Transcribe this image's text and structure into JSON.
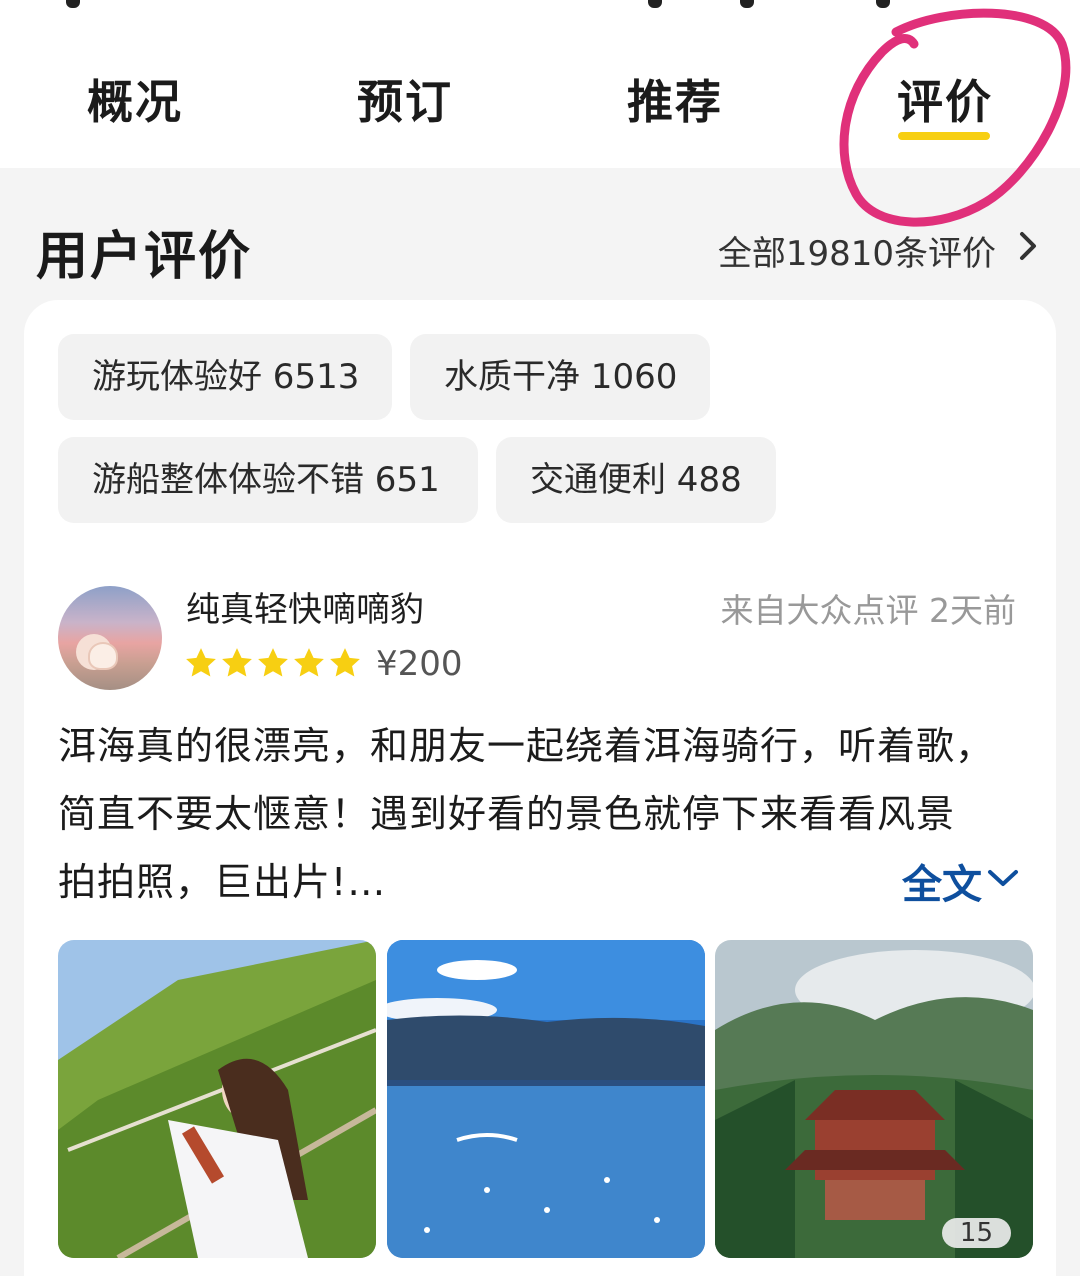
{
  "tabs": [
    {
      "label": "概况"
    },
    {
      "label": "预订"
    },
    {
      "label": "推荐"
    },
    {
      "label": "评价"
    }
  ],
  "active_tab": "评价",
  "section": {
    "title": "用户评价",
    "all_reviews": "全部19810条评价"
  },
  "tags": [
    {
      "label": "游玩体验好 6513"
    },
    {
      "label": "水质干净 1060"
    },
    {
      "label": "游船整体体验不错 651"
    },
    {
      "label": "交通便利 488"
    }
  ],
  "review": {
    "username": "纯真轻快嘀嘀豹",
    "source": "来自大众点评 2天前",
    "rating_stars": 5,
    "price": "¥200",
    "text_lines": [
      "洱海真的很漂亮，和朋友一起绕着洱海骑行，听着歌，",
      "简直不要太惬意！遇到好看的景色就停下来看看风景",
      "拍拍照，巨出片!…"
    ],
    "fulltext_label": "全文",
    "photo_count": "15"
  },
  "colors": {
    "tab_underline": "#f7cf12",
    "star": "#f7cf12",
    "link_blue": "#0e4f9e",
    "annotation": "#e0307a"
  }
}
